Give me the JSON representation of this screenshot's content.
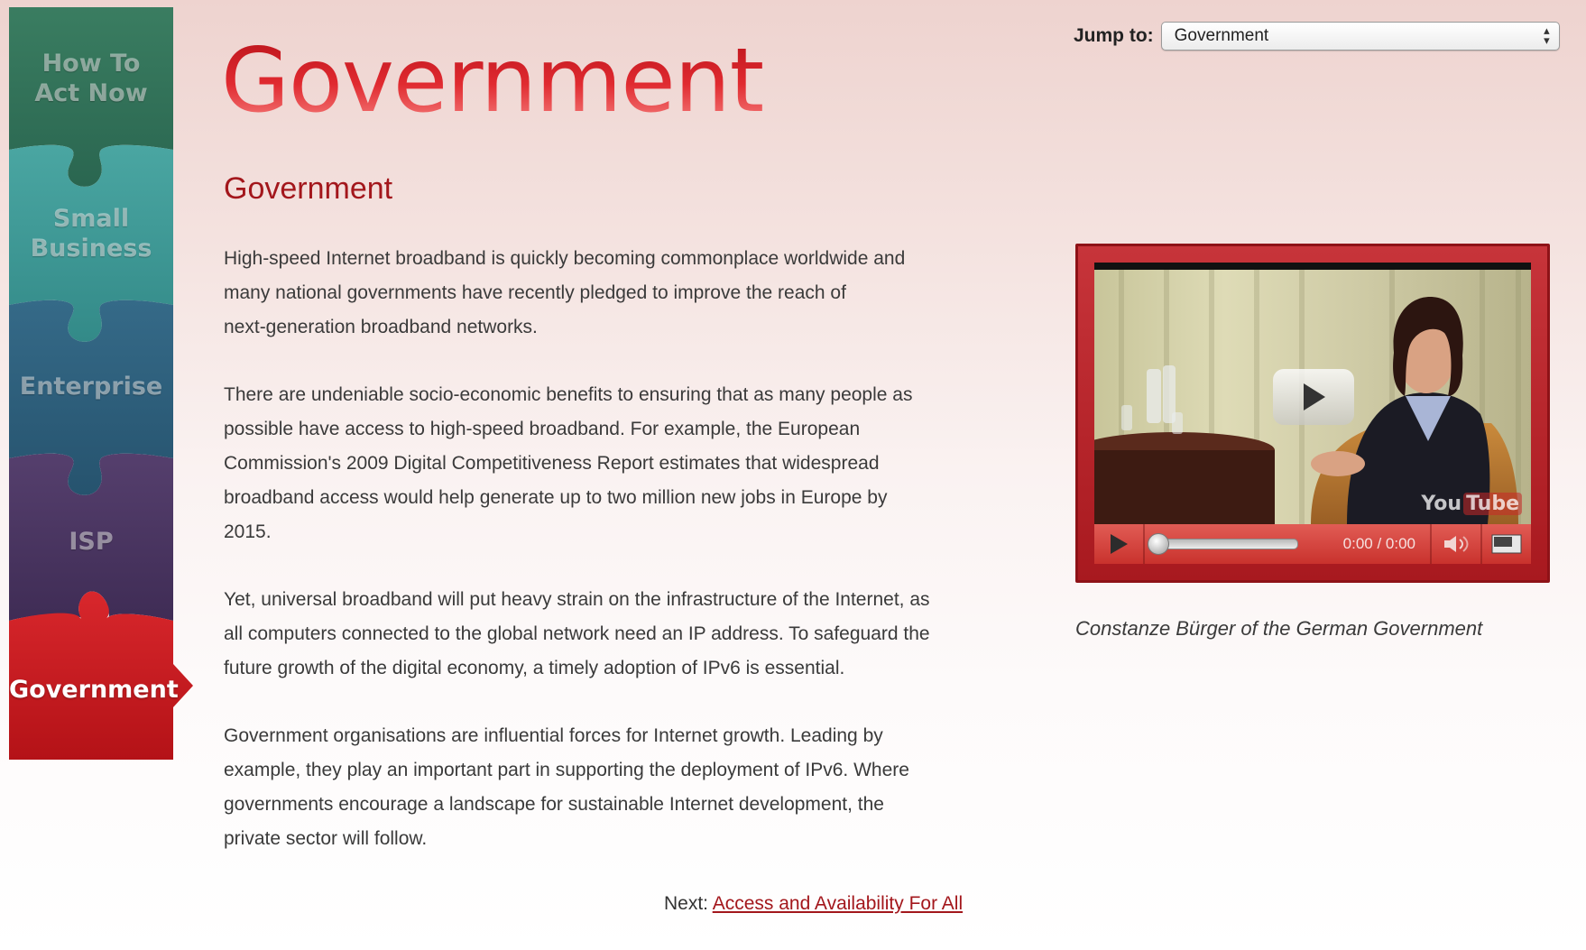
{
  "sidebar": {
    "items": [
      {
        "label_line1": "How To",
        "label_line2": "Act Now",
        "color": "#2f6d55"
      },
      {
        "label_line1": "Small",
        "label_line2": "Business",
        "color": "#3a9491"
      },
      {
        "label": "Enterprise",
        "color": "#2d5c78"
      },
      {
        "label": "ISP",
        "color": "#4a3660"
      },
      {
        "label": "Government",
        "color": "#c41a1f",
        "active": true
      }
    ]
  },
  "header": {
    "banner_title": "Government",
    "jump_label": "Jump to:",
    "jump_selected": "Government"
  },
  "main": {
    "title": "Government",
    "paragraphs": [
      [
        "High-speed Internet broadband is quickly becoming commonplace worldwide and",
        "many national governments have recently pledged to improve the reach of",
        "next-generation broadband networks."
      ],
      [
        "There are undeniable socio-economic benefits to ensuring that as many people as",
        "possible have access to high-speed broadband. For example, the European",
        "Commission's 2009 Digital Competitiveness Report estimates that widespread",
        "broadband access would help generate up to two million new jobs in Europe by",
        "2015."
      ],
      [
        "Yet, universal broadband will put heavy strain on the infrastructure of the Internet, as",
        "all computers connected to the global network need an IP address. To safeguard the",
        "future growth of the digital economy, a timely adoption of IPv6 is essential."
      ],
      [
        "Government organisations are influential forces for Internet growth. Leading by",
        "example, they play an important part in supporting the deployment of IPv6. Where",
        "governments encourage a landscape for sustainable Internet development, the",
        "private sector will follow."
      ]
    ],
    "next_label": "Next:",
    "next_link": "Access and Availability For All"
  },
  "video": {
    "time": "0:00 / 0:00",
    "progress": 0,
    "logo_you": "You",
    "logo_tube": "Tube",
    "caption": "Constanze Bürger of the German Government"
  }
}
